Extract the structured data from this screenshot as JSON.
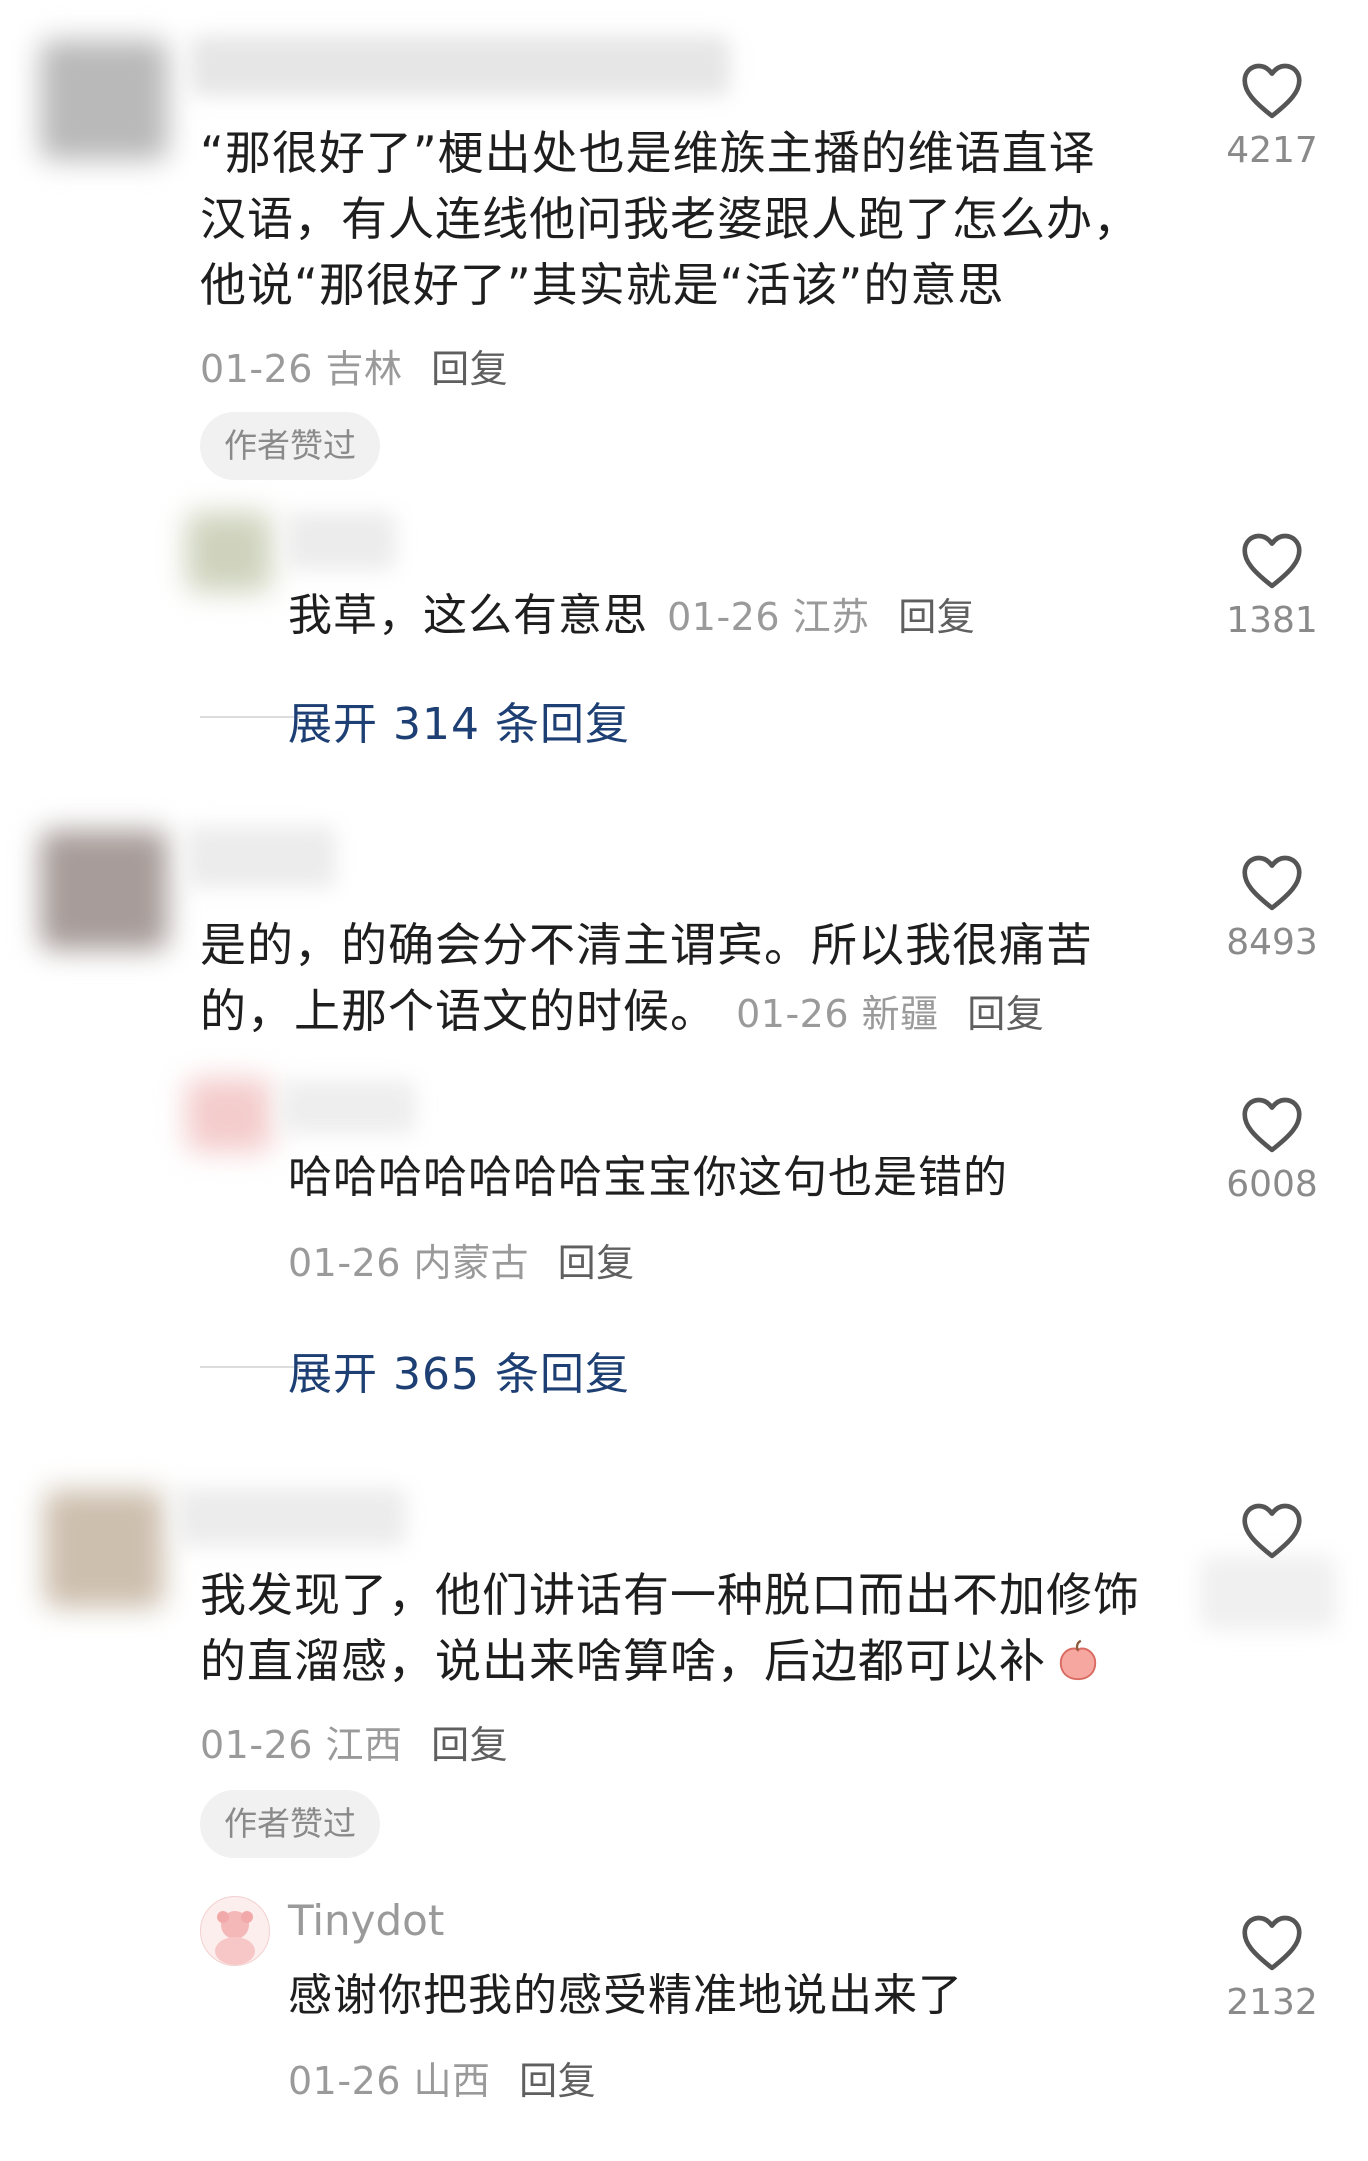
{
  "comments": [
    {
      "text": "“那很好了”梗出处也是维族主播的维语直译\n汉语，有人连线他问我老婆跟人跑了怎么办，\n他说“那很好了”其实就是“活该”的意思",
      "date": "01-26",
      "location": "吉林",
      "reply_label": "回复",
      "badge": "作者赞过",
      "likes": "4217",
      "sub_reply": {
        "text": "我草，这么有意思",
        "date": "01-26",
        "location": "江苏",
        "reply_label": "回复",
        "likes": "1381"
      },
      "expand": "展开 314 条回复"
    },
    {
      "text_line1": "是的，的确会分不清主谓宾。所以我很痛苦",
      "text_line2": "的，上那个语文的时候。",
      "date": "01-26",
      "location": "新疆",
      "reply_label": "回复",
      "likes": "8493",
      "sub_reply": {
        "text": "哈哈哈哈哈哈哈宝宝你这句也是错的",
        "date": "01-26",
        "location": "内蒙古",
        "reply_label": "回复",
        "likes": "6008"
      },
      "expand": "展开 365 条回复"
    },
    {
      "text_line1": "我发现了，他们讲话有一种脱口而出不加修饰",
      "text_line2": "的直溜感，说出来啥算啥，后边都可以补",
      "date": "01-26",
      "location": "江西",
      "reply_label": "回复",
      "badge": "作者赞过",
      "sub_reply": {
        "username": "Tinydot",
        "text": "感谢你把我的感受精准地说出来了",
        "date": "01-26",
        "location": "山西",
        "reply_label": "回复",
        "likes": "2132"
      }
    }
  ],
  "icons": {
    "like": "heart-outline-icon",
    "emoji": "peach-emoji"
  },
  "colors": {
    "text": "#1e1e1e",
    "meta": "#9a9a9a",
    "expand": "#1d3f73",
    "badge_bg": "#f1f1f1"
  }
}
